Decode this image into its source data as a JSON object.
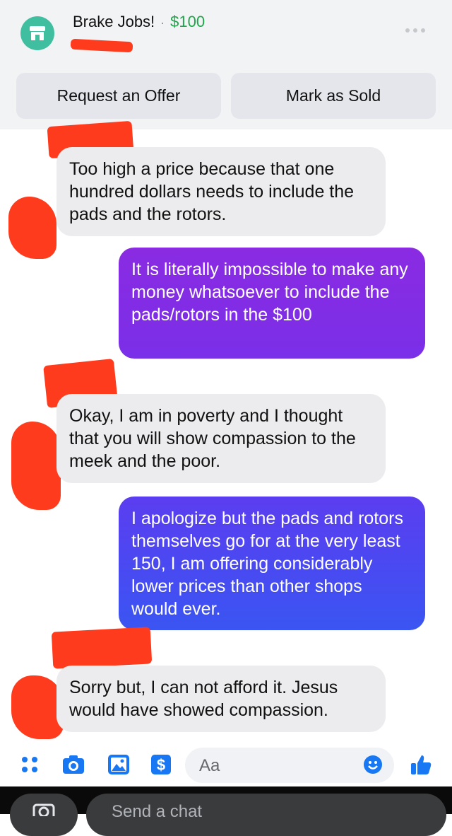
{
  "header": {
    "title": "Brake Jobs!",
    "separator": "·",
    "price": "$100",
    "buttons": {
      "request_offer": "Request an Offer",
      "mark_sold": "Mark as Sold"
    }
  },
  "messages": [
    {
      "direction": "incoming",
      "text": "Too high a price because that one hundred dollars needs to include the pads and the rotors."
    },
    {
      "direction": "outgoing",
      "text": "It is literally impossible to make any money whatsoever to include the pads/rotors in the $100"
    },
    {
      "direction": "incoming",
      "text": "Okay, I am in poverty and I thought that you will show compassion to the meek and the poor."
    },
    {
      "direction": "outgoing",
      "text": "I apologize but the pads and rotors themselves go for at the very least 150, I am offering considerably lower prices than other shops would ever."
    },
    {
      "direction": "incoming",
      "text": "Sorry but, I can not afford it. Jesus would have showed compassion."
    }
  ],
  "composer": {
    "placeholder": "Aa"
  },
  "bottom": {
    "send_text": "Send a chat"
  },
  "colors": {
    "outgoing_1": "#8a2be2",
    "outgoing_2": "#5b3df0",
    "price": "#1ea64a",
    "icon_blue": "#1877f2",
    "redaction": "#ff3b1d"
  }
}
